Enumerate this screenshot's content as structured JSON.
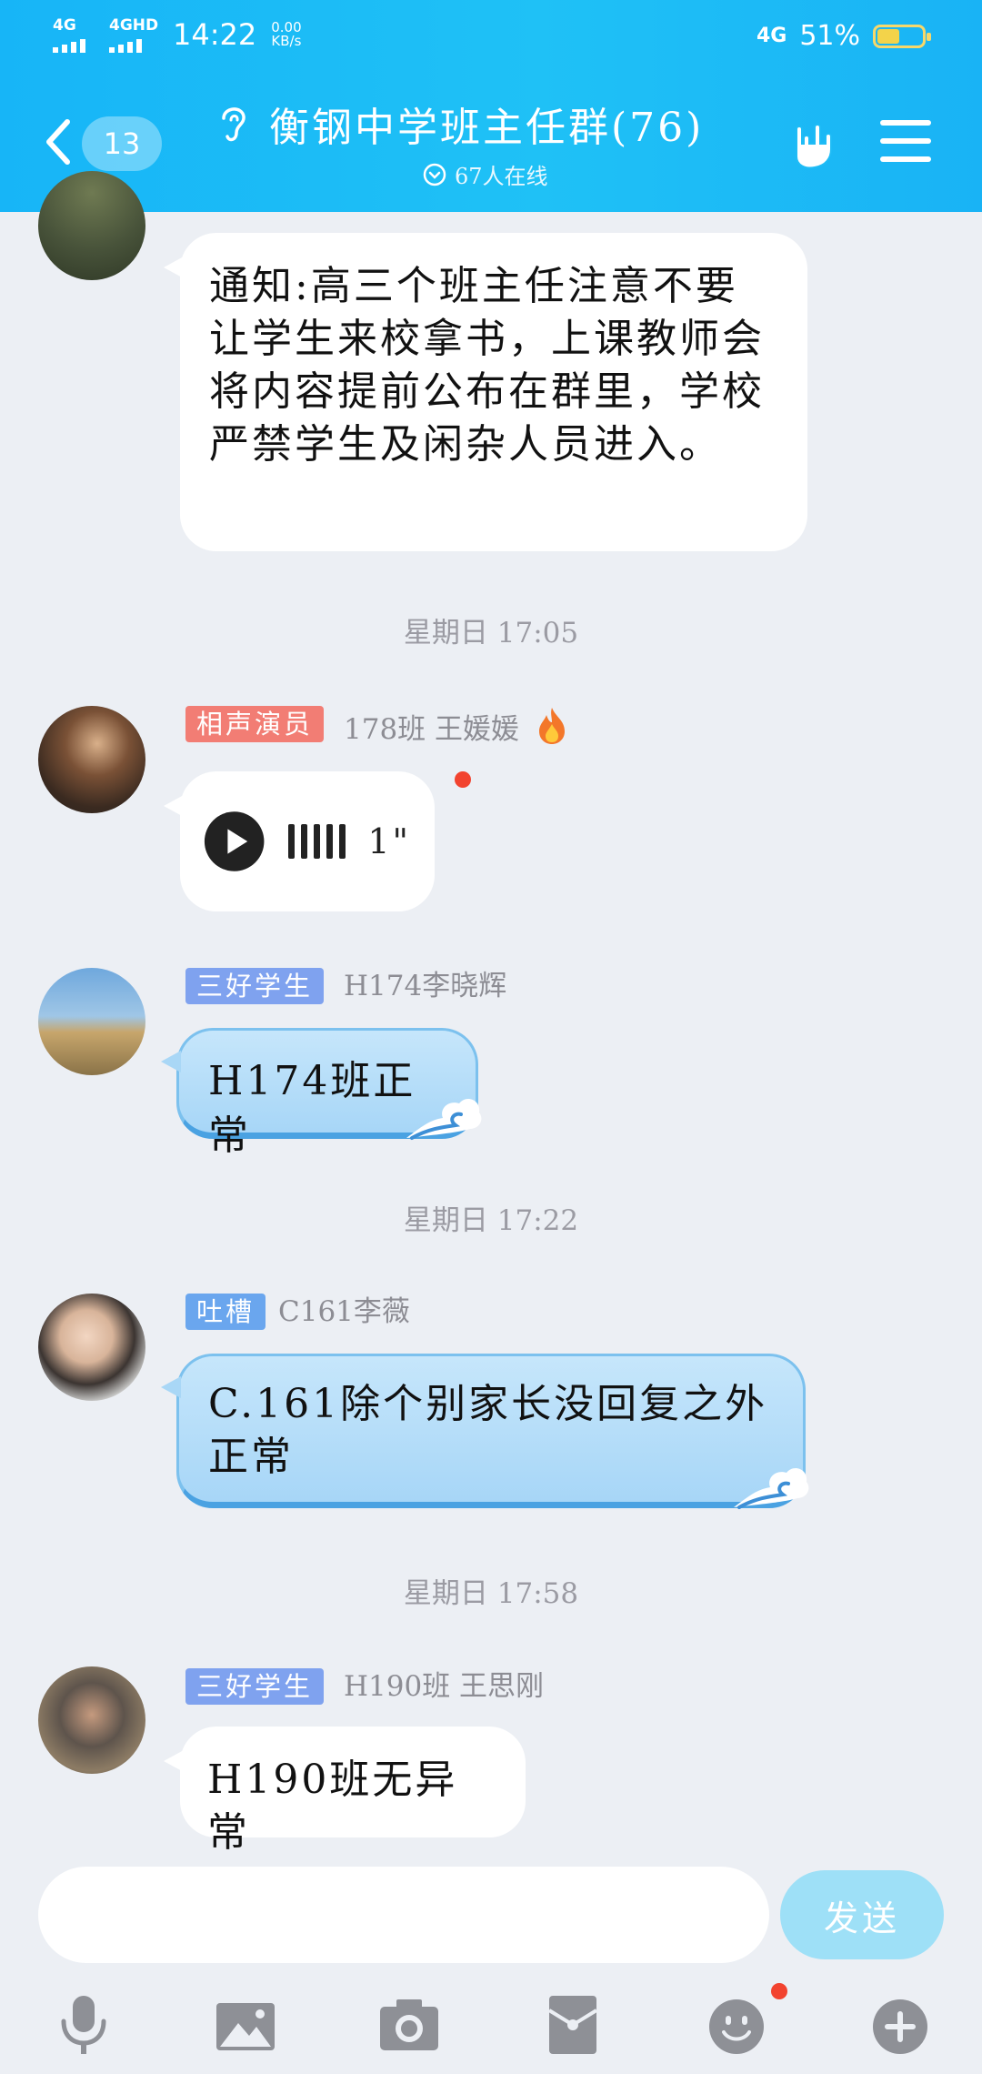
{
  "status_bar": {
    "signal_1_label": "4G",
    "signal_2_label": "4GHD",
    "time": "14:22",
    "speed_value": "0.00",
    "speed_unit": "KB/s",
    "network_right": "4G",
    "battery": "51%",
    "battery_level": 0.51
  },
  "header": {
    "unread_count": "13",
    "title": "衡钢中学班主任群(76)",
    "online": "67人在线"
  },
  "messages": [
    {
      "type": "text",
      "text": "通知:高三个班主任注意不要让学生来校拿书，上课教师会将内容提前公布在群里，学校严禁学生及闲杂人员进入。"
    },
    {
      "type": "time",
      "text": "星期日 17:05"
    },
    {
      "type": "voice",
      "badge": "相声演员",
      "sender": "178班 王媛媛",
      "duration": "1\"",
      "badge_color": "#f27d74"
    },
    {
      "type": "text",
      "badge": "三好学生",
      "sender": "H174李晓辉",
      "text": "H174班正常",
      "badge_color": "#7fa2ef"
    },
    {
      "type": "time",
      "text": "星期日 17:22"
    },
    {
      "type": "text",
      "badge": "吐槽",
      "sender": "C161李薇",
      "text": "C.161除个别家长没回复之外正常",
      "badge_color": "#6aa6ee"
    },
    {
      "type": "time",
      "text": "星期日 17:58"
    },
    {
      "type": "text",
      "badge": "三好学生",
      "sender": "H190班  王思刚",
      "text": "H190班无异常",
      "badge_color": "#7fa2ef"
    }
  ],
  "input": {
    "value": "",
    "send_label": "发送"
  },
  "toolbar": [
    "mic-icon",
    "image-icon",
    "camera-icon",
    "red-packet-icon",
    "emoji-icon",
    "plus-icon"
  ],
  "colors": {
    "header": "#1fbcf6",
    "background": "#eceff4",
    "send_button": "#9ee0f7"
  }
}
